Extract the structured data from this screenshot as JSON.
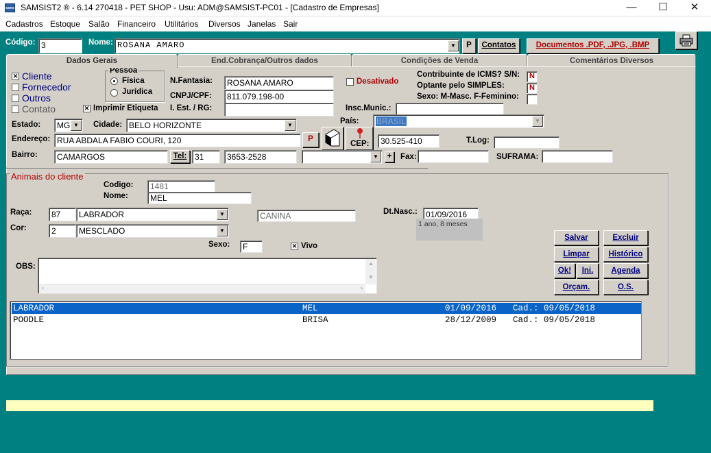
{
  "window": {
    "title": "SAMSIST2 ® - 6.14  270418 - PET SHOP - Usu: ADM@SAMSIST-PC01 - [Cadastro de Empresas]",
    "app_icon_text": "sams",
    "min": "—",
    "max": "☐",
    "close": "✕"
  },
  "menu": [
    "Cadastros",
    "Estoque",
    "Salão",
    "Financeiro",
    "Utilitários",
    "Diversos",
    "Janelas",
    "Sair"
  ],
  "top": {
    "codigo_label": "Código:",
    "codigo_value": "3",
    "nome_label": "Nome:",
    "nome_value": "ROSANA AMARO",
    "p_label": "P",
    "contatos_label": "Contatos",
    "documentos_label": "Documentos .PDF, .JPG, .BMP"
  },
  "tabs": [
    "Dados Gerais",
    "End.Cobrança/Outros dados",
    "Condições de Venda",
    "Comentários Diversos"
  ],
  "tipo": {
    "cliente": "Cliente",
    "fornecedor": "Fornecedor",
    "outros": "Outros",
    "contato": "Contato",
    "imprimir": "Imprimir Etiqueta"
  },
  "pessoa": {
    "label": "Pessoa",
    "fisica": "Física",
    "juridica": "Jurídica"
  },
  "fields": {
    "fantasia_label": "N.Fantasia:",
    "fantasia": "ROSANA AMARO",
    "cnpj_label": "CNPJ/CPF:",
    "cnpj": "811.079.198-00",
    "ie_label": "I. Est. / RG:",
    "ie": "",
    "desativado": "Desativado",
    "icms_label": "Contribuinte de ICMS? S/N:",
    "icms": "N",
    "simples_label": "Optante pelo SIMPLES:",
    "simples": "N",
    "sexo_label": "Sexo: M-Masc. F-Feminino:",
    "sexo": "",
    "insc_label": "Insc.Munic.:",
    "insc": "",
    "estado_label": "Estado:",
    "estado": "MG",
    "cidade_label": "Cidade:",
    "cidade": "BELO HORIZONTE",
    "pais_label": "País:",
    "pais": "BRASIL",
    "end_label": "Endereço:",
    "endereco": "RUA ABDALA FABIO COURI, 120",
    "cep_label": "CEP:",
    "cep": "30.525-410",
    "tlog_label": "T.Log:",
    "tlog": "",
    "bairro_label": "Bairro:",
    "bairro": "CAMARGOS",
    "tel_label": "Tel:",
    "ddd": "31",
    "tel": "3653-2528",
    "fax_label": "Fax:",
    "fax": "",
    "suframa_label": "SUFRAMA:",
    "suframa": "",
    "plus": "+"
  },
  "animais": {
    "title": "Animais do cliente",
    "codigo_label": "Codigo:",
    "codigo": "1481",
    "nome_label": "Nome:",
    "nome": "MEL",
    "raca_label": "Raça:",
    "raca_cod": "87",
    "raca": "LABRADOR",
    "especie": "CANINA",
    "cor_label": "Cor:",
    "cor_cod": "2",
    "cor": "MESCLADO",
    "nasc_label": "Dt.Nasc.:",
    "nasc": "01/09/2016",
    "idade": "1 ano,  8 meses",
    "sexo_label": "Sexo:",
    "sexo": "F",
    "vivo": "Vivo",
    "obs_label": "OBS:",
    "obs": ""
  },
  "buttons": {
    "salvar": "Salvar",
    "excluir": "Excluir",
    "limpar": "Limpar",
    "historico": "Histórico",
    "ok": "Ok!",
    "ini": "Ini.",
    "agenda": "Agenda",
    "orcam": "Orçam.",
    "os": "O.S."
  },
  "list": [
    {
      "raca": "LABRADOR",
      "nome": "MEL",
      "nasc": "01/09/2016",
      "cad": "Cad.: 09/05/2018",
      "selected": true
    },
    {
      "raca": "POODLE",
      "nome": "BRISA",
      "nasc": "28/12/2009",
      "cad": "Cad.: 09/05/2018",
      "selected": false
    }
  ],
  "icons": {
    "printer": "printer-icon",
    "map_pin": "map-pin-icon",
    "phone_book": "book-icon"
  }
}
